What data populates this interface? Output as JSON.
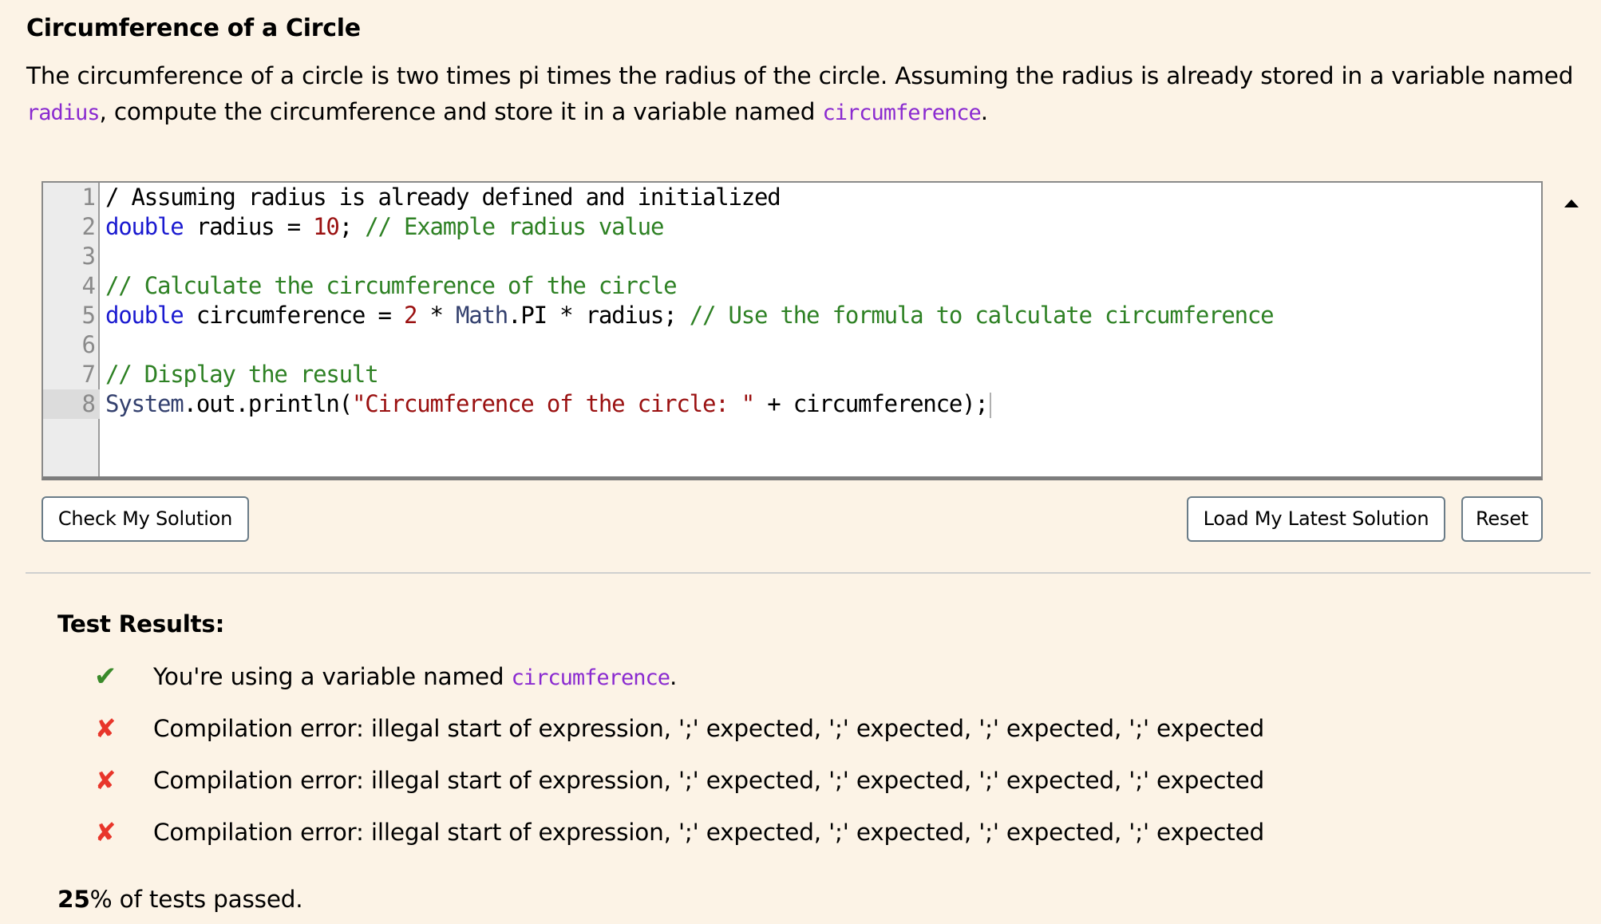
{
  "problem": {
    "title": "Circumference of a Circle",
    "description": {
      "part1": "The circumference of a circle is two times pi times the radius of the circle. Assuming the radius is already stored in a variable named ",
      "code1": "radius",
      "part2": ", compute the circumference and store it in a variable named ",
      "code2": "circumference",
      "part3": "."
    }
  },
  "editor": {
    "active_line": 8,
    "line_numbers": [
      "1",
      "2",
      "3",
      "4",
      "5",
      "6",
      "7",
      "8"
    ],
    "lines": [
      [
        {
          "t": "/ Assuming radius is already defined and initialized",
          "c": "plain"
        }
      ],
      [
        {
          "t": "double",
          "c": "keyword"
        },
        {
          "t": " radius = ",
          "c": "plain"
        },
        {
          "t": "10",
          "c": "number"
        },
        {
          "t": "; ",
          "c": "plain"
        },
        {
          "t": "// Example radius value",
          "c": "comment"
        }
      ],
      [],
      [
        {
          "t": "// Calculate the circumference of the circle",
          "c": "comment"
        }
      ],
      [
        {
          "t": "double",
          "c": "keyword"
        },
        {
          "t": " circumference = ",
          "c": "plain"
        },
        {
          "t": "2",
          "c": "number"
        },
        {
          "t": " * ",
          "c": "plain"
        },
        {
          "t": "Math",
          "c": "var2"
        },
        {
          "t": ".PI * radius; ",
          "c": "plain"
        },
        {
          "t": "// Use the formula to calculate circumference",
          "c": "comment"
        }
      ],
      [],
      [
        {
          "t": "// Display the result",
          "c": "comment"
        }
      ],
      [
        {
          "t": "System",
          "c": "var2"
        },
        {
          "t": ".out.println(",
          "c": "plain"
        },
        {
          "t": "\"Circumference of the circle: \"",
          "c": "string"
        },
        {
          "t": " + circumference);",
          "c": "plain"
        }
      ]
    ]
  },
  "buttons": {
    "check": "Check My Solution",
    "load_latest": "Load My Latest Solution",
    "reset": "Reset"
  },
  "results": {
    "title": "Test Results:",
    "items": [
      {
        "status": "pass",
        "icon": "check-icon",
        "glyph": "✔",
        "text": "You're using a variable named ",
        "code": "circumference",
        "suffix": "."
      },
      {
        "status": "fail",
        "icon": "x-icon",
        "glyph": "✘",
        "text": "Compilation error: illegal start of expression, ';' expected, ';' expected, ';' expected, ';' expected",
        "code": "",
        "suffix": ""
      },
      {
        "status": "fail",
        "icon": "x-icon",
        "glyph": "✘",
        "text": "Compilation error: illegal start of expression, ';' expected, ';' expected, ';' expected, ';' expected",
        "code": "",
        "suffix": ""
      },
      {
        "status": "fail",
        "icon": "x-icon",
        "glyph": "✘",
        "text": "Compilation error: illegal start of expression, ';' expected, ';' expected, ';' expected, ';' expected",
        "code": "",
        "suffix": ""
      }
    ],
    "summary_percent": "25",
    "summary_percent_sign": "%",
    "summary_text": " of tests passed."
  },
  "colors": {
    "background": "#fcf3e6",
    "inline_code": "#8a2ad0",
    "pass": "#3a8a2a",
    "fail": "#e8352a",
    "keyword": "#1a1ad0",
    "number": "#9a1010",
    "comment": "#2e8124",
    "string": "#9a1010",
    "variable2": "#33406e"
  }
}
